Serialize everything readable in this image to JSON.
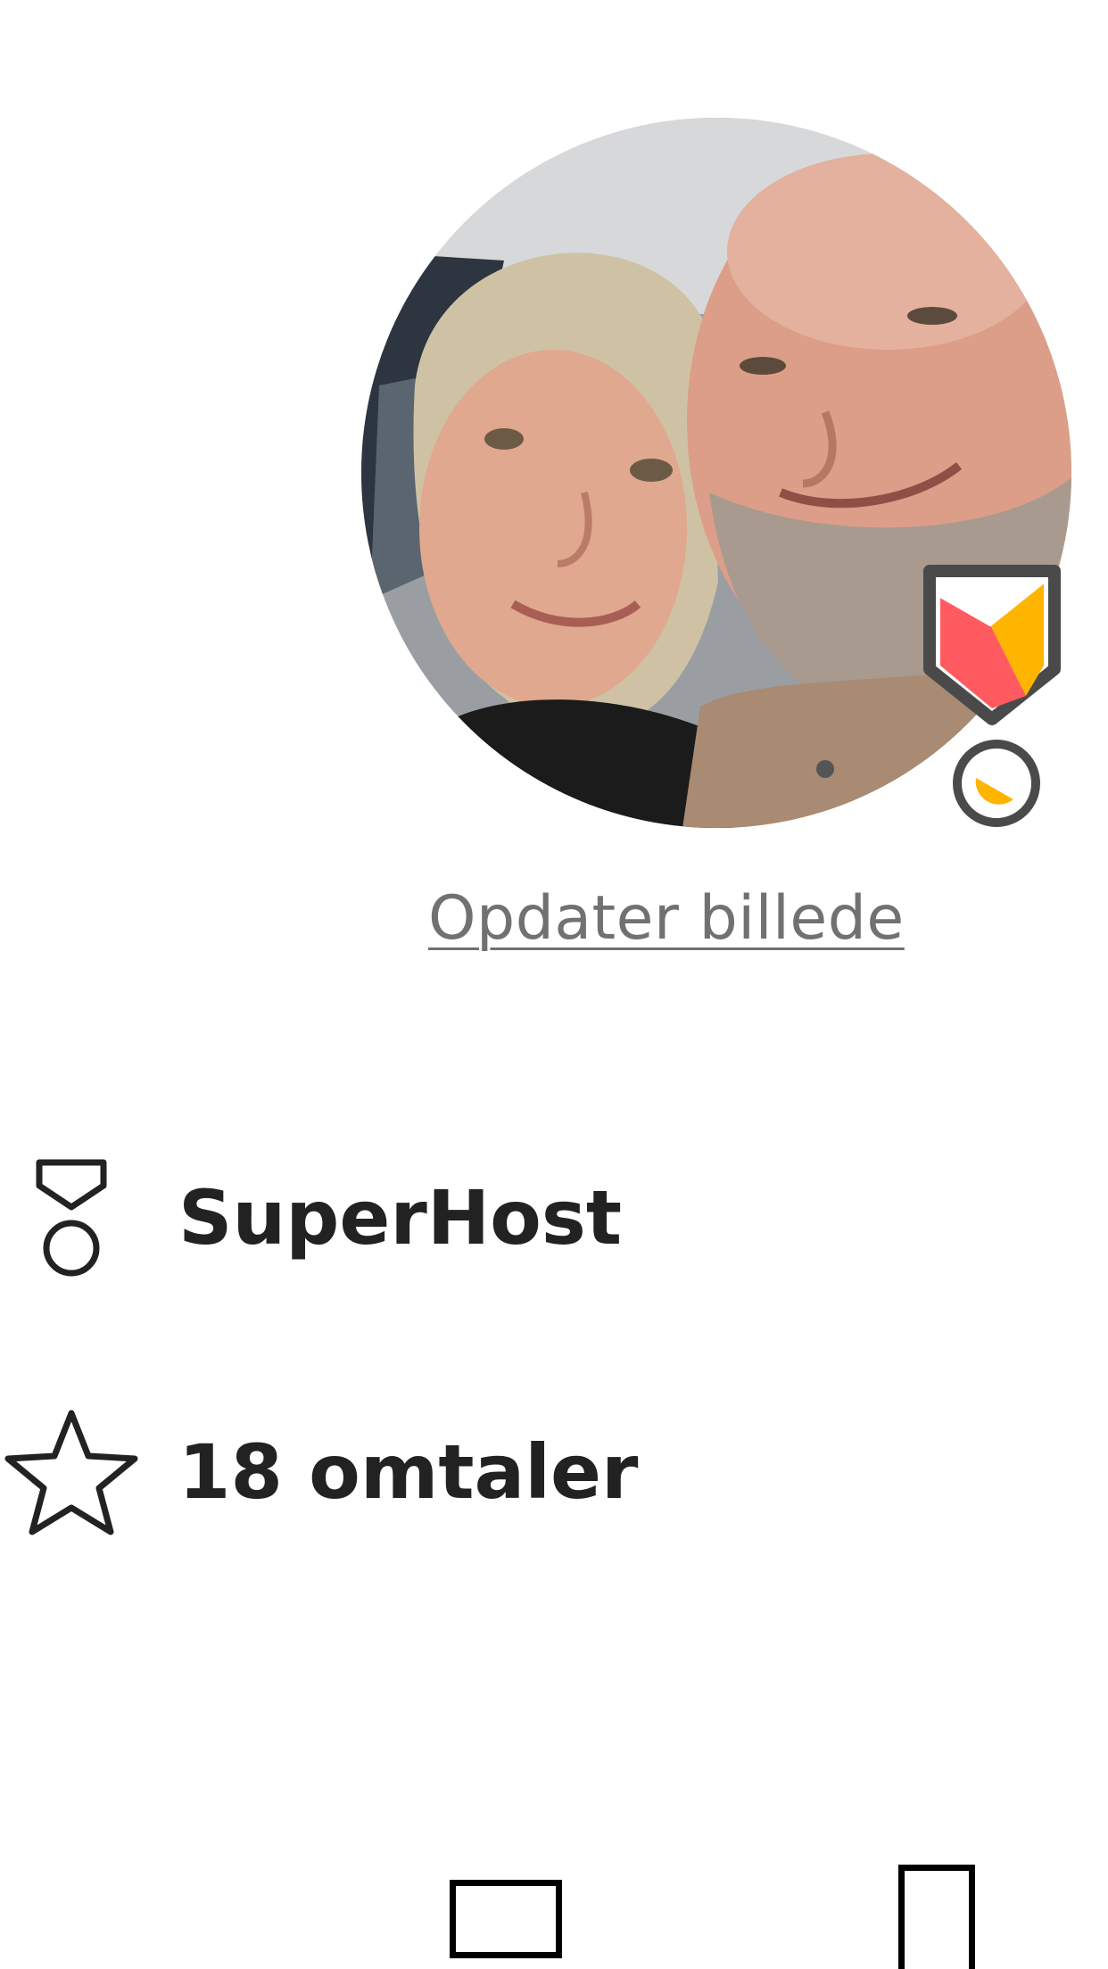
{
  "profile": {
    "update_photo_label": "Opdater billede",
    "superhost_label": "SuperHost",
    "reviews_label": "18 omtaler"
  },
  "icons": {
    "avatar": "profile-photo",
    "badge": "superhost-badge-icon",
    "superhost_row": "medal-icon",
    "reviews_row": "star-icon",
    "bottom_left": "square-icon",
    "bottom_right": "rectangle-icon"
  },
  "colors": {
    "text": "#222222",
    "muted_link": "#717171",
    "badge_red": "#FF5A5F",
    "badge_yellow": "#FFB400",
    "badge_outline": "#4A4A4A"
  }
}
